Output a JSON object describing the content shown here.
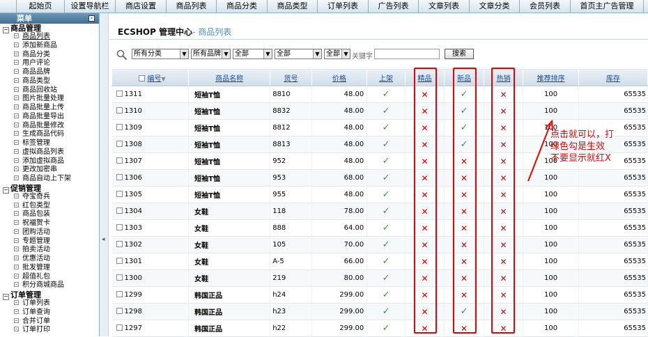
{
  "topnav": {
    "tabs": [
      {
        "label": "起始页",
        "w": 69
      },
      {
        "label": "设置导航栏",
        "w": 73
      },
      {
        "label": "商店设置",
        "w": 73
      },
      {
        "label": "商品列表",
        "w": 72
      },
      {
        "label": "商品分类",
        "w": 73
      },
      {
        "label": "商品类型",
        "w": 72
      },
      {
        "label": "订单列表",
        "w": 73
      },
      {
        "label": "广告列表",
        "w": 72
      },
      {
        "label": "文章列表",
        "w": 73
      },
      {
        "label": "文章分类",
        "w": 72
      },
      {
        "label": "会员列表",
        "w": 73
      },
      {
        "label": "首页主广告管理",
        "w": 105
      }
    ]
  },
  "sidebar": {
    "header": "菜单",
    "groups": [
      {
        "title": "商品管理",
        "items": [
          "商品列表",
          "添加新商品",
          "商品分类",
          "用户评论",
          "商品品牌",
          "商品类型",
          "商品回收站",
          "图片批量处理",
          "商品批量上传",
          "商品批量导出",
          "商品批量修改",
          "生成商品代码",
          "标签管理",
          "虚拟商品列表",
          "添加虚拟商品",
          "更改加密串",
          "商品自动上下架"
        ]
      },
      {
        "title": "促销管理",
        "items": [
          "夺宝奇兵",
          "红包类型",
          "商品包装",
          "祝福贺卡",
          "团购活动",
          "专题管理",
          "拍卖活动",
          "优惠活动",
          "批发管理",
          "超值礼包",
          "积分商城商品"
        ]
      },
      {
        "title": "订单管理",
        "items": [
          "订单列表",
          "订单查询",
          "合并订单",
          "订单打印"
        ]
      }
    ]
  },
  "breadcrumb": {
    "title": "ECSHOP 管理中心",
    "sub": "- 商品列表"
  },
  "filter": {
    "category": "所有分类",
    "brand": "所有品牌",
    "select3": "全部",
    "select4": "全部",
    "select5": "全部",
    "keyword_label": "关键字",
    "keyword_value": "",
    "search_button": "搜索"
  },
  "table": {
    "headers": {
      "id": "编号",
      "name": "商品名称",
      "sn": "货号",
      "price": "价格",
      "on_sale": "上架",
      "best": "精品",
      "new": "新品",
      "hot": "热销",
      "sort": "推荐排序",
      "stock": "库存"
    },
    "rows": [
      {
        "id": "1311",
        "name": "短袖T恤",
        "sn": "8810",
        "price": "48.00",
        "on_sale": true,
        "best": false,
        "new": true,
        "hot": false,
        "sort": "100",
        "stock": "65535"
      },
      {
        "id": "1310",
        "name": "短袖T恤",
        "sn": "8832",
        "price": "48.00",
        "on_sale": true,
        "best": false,
        "new": true,
        "hot": false,
        "sort": "100",
        "stock": "65535"
      },
      {
        "id": "1309",
        "name": "短袖T恤",
        "sn": "8812",
        "price": "48.00",
        "on_sale": true,
        "best": false,
        "new": true,
        "hot": false,
        "sort": "100",
        "stock": "65535"
      },
      {
        "id": "1308",
        "name": "短袖T恤",
        "sn": "8813",
        "price": "48.00",
        "on_sale": true,
        "best": false,
        "new": true,
        "hot": false,
        "sort": "100",
        "stock": "65535"
      },
      {
        "id": "1307",
        "name": "短袖T恤",
        "sn": "952",
        "price": "48.00",
        "on_sale": true,
        "best": false,
        "new": false,
        "hot": false,
        "sort": "100",
        "stock": "65535"
      },
      {
        "id": "1306",
        "name": "短袖T恤",
        "sn": "953",
        "price": "68.00",
        "on_sale": true,
        "best": false,
        "new": false,
        "hot": false,
        "sort": "100",
        "stock": "65535"
      },
      {
        "id": "1305",
        "name": "短袖T恤",
        "sn": "955",
        "price": "48.00",
        "on_sale": true,
        "best": false,
        "new": false,
        "hot": false,
        "sort": "100",
        "stock": "65535"
      },
      {
        "id": "1304",
        "name": "女鞋",
        "sn": "118",
        "price": "78.00",
        "on_sale": true,
        "best": false,
        "new": false,
        "hot": false,
        "sort": "100",
        "stock": "65535"
      },
      {
        "id": "1303",
        "name": "女鞋",
        "sn": "888",
        "price": "64.00",
        "on_sale": true,
        "best": false,
        "new": false,
        "hot": false,
        "sort": "100",
        "stock": "65535"
      },
      {
        "id": "1302",
        "name": "女鞋",
        "sn": "105",
        "price": "70.00",
        "on_sale": true,
        "best": false,
        "new": false,
        "hot": false,
        "sort": "100",
        "stock": "65535"
      },
      {
        "id": "1301",
        "name": "女鞋",
        "sn": "A-5",
        "price": "66.00",
        "on_sale": true,
        "best": false,
        "new": false,
        "hot": false,
        "sort": "100",
        "stock": "65535"
      },
      {
        "id": "1300",
        "name": "女鞋",
        "sn": "219",
        "price": "80.00",
        "on_sale": true,
        "best": false,
        "new": false,
        "hot": false,
        "sort": "100",
        "stock": "65535"
      },
      {
        "id": "1299",
        "name": "韩国正品",
        "sn": "h24",
        "price": "299.00",
        "on_sale": true,
        "best": false,
        "new": false,
        "hot": false,
        "sort": "100",
        "stock": "65535"
      },
      {
        "id": "1298",
        "name": "韩国正品",
        "sn": "h23",
        "price": "299.00",
        "on_sale": true,
        "best": false,
        "new": true,
        "hot": false,
        "sort": "100",
        "stock": "65535"
      },
      {
        "id": "1297",
        "name": "韩国正品",
        "sn": "h22",
        "price": "299.00",
        "on_sale": true,
        "best": false,
        "new": false,
        "hot": false,
        "sort": "100",
        "stock": "65535"
      }
    ]
  },
  "annotation": {
    "lines": [
      "点击就可以，打",
      "绿色勾是生效",
      "不要显示就红X"
    ],
    "color": "#ee0000"
  },
  "icons": {
    "yes": "✓",
    "no": "✕"
  }
}
